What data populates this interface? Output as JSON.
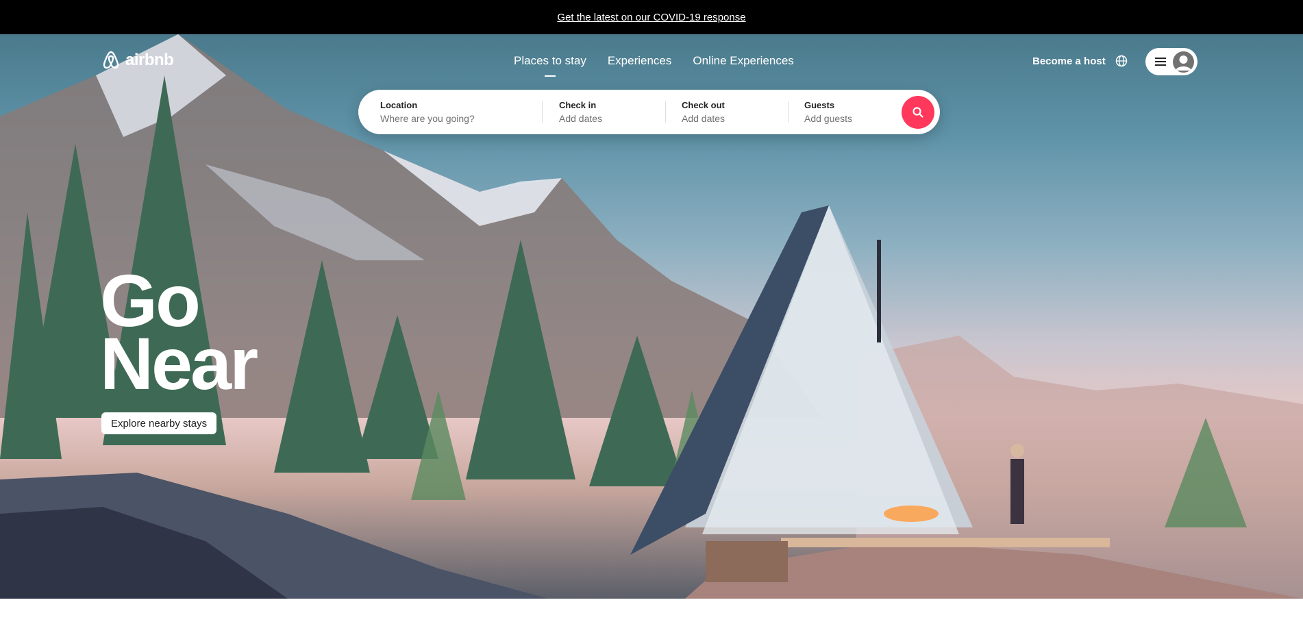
{
  "banner": {
    "link_text": "Get the latest on our COVID-19 response"
  },
  "header": {
    "logo_text": "airbnb",
    "nav": [
      {
        "label": "Places to stay",
        "active": true
      },
      {
        "label": "Experiences",
        "active": false
      },
      {
        "label": "Online Experiences",
        "active": false
      }
    ],
    "host_link": "Become a host",
    "icons": {
      "language": "globe-icon",
      "menu": "hamburger-icon",
      "profile": "user-avatar-icon"
    }
  },
  "search": {
    "location": {
      "label": "Location",
      "placeholder": "Where are you going?"
    },
    "check_in": {
      "label": "Check in",
      "value": "Add dates"
    },
    "check_out": {
      "label": "Check out",
      "value": "Add dates"
    },
    "guests": {
      "label": "Guests",
      "value": "Add guests"
    },
    "button_icon": "search-icon"
  },
  "hero": {
    "title_line1": "Go",
    "title_line2": "Near",
    "cta_label": "Explore nearby stays"
  },
  "colors": {
    "brand": "#ff385c",
    "banner_bg": "#000000"
  }
}
